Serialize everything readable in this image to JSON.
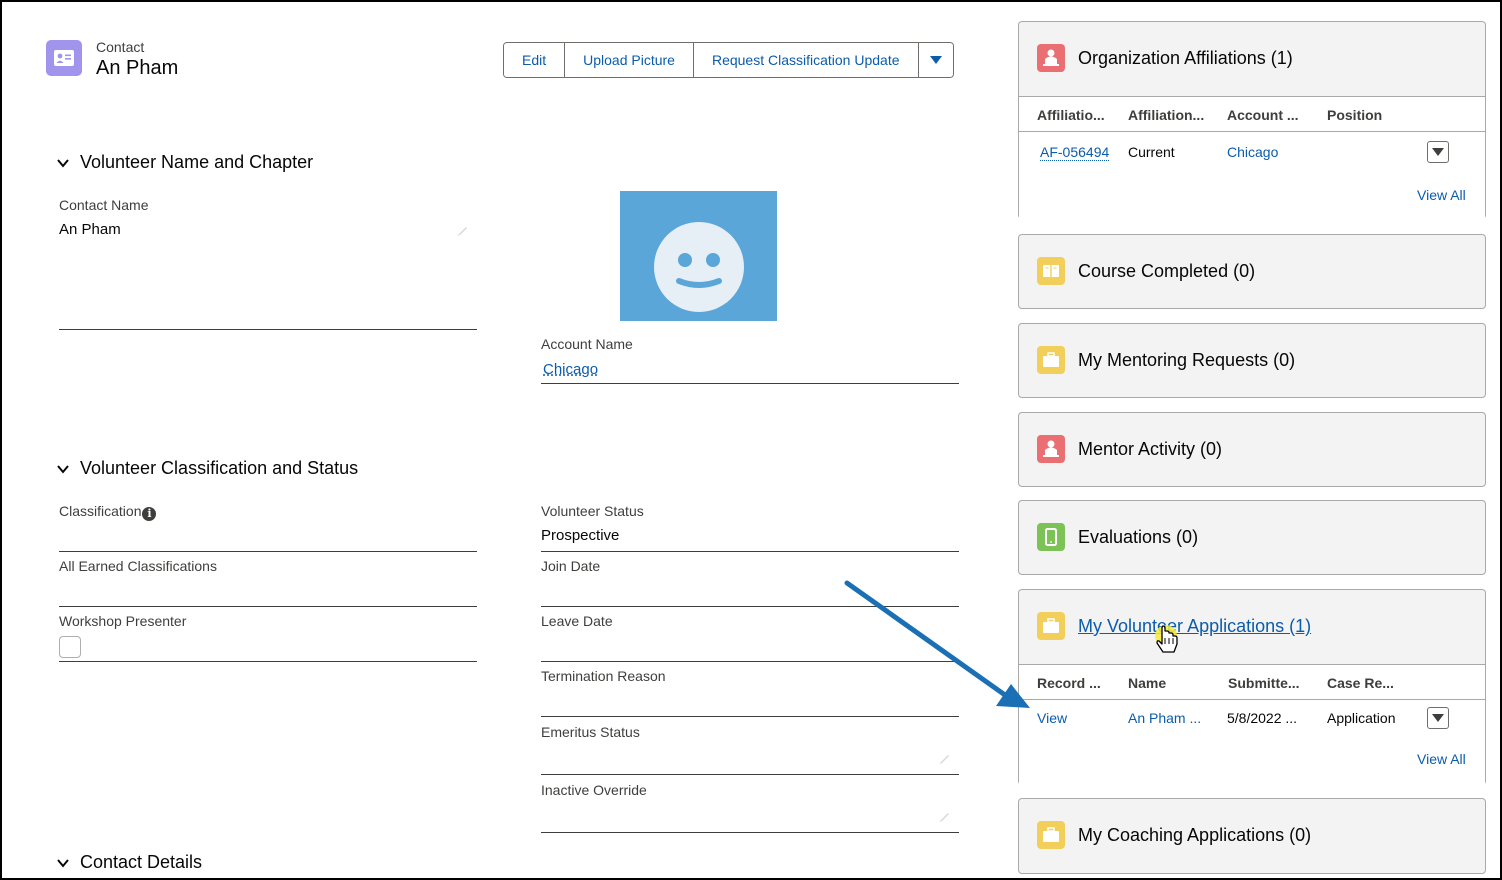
{
  "header": {
    "object_type": "Contact",
    "record_name": "An Pham",
    "actions": [
      {
        "label": "Edit"
      },
      {
        "label": "Upload Picture"
      },
      {
        "label": "Request Classification Update"
      }
    ],
    "colors": {
      "contact_icon": "#a094ed",
      "link": "#0b5cab"
    }
  },
  "sections": {
    "name_chapter": {
      "title": "Volunteer Name and Chapter",
      "contact_name_label": "Contact Name",
      "contact_name_value": "An Pham",
      "account_name_label": "Account Name",
      "account_name_value": "Chicago"
    },
    "classification_status": {
      "title": "Volunteer Classification and Status",
      "classification_label": "Classification",
      "info_glyph": "i",
      "all_earned_label": "All Earned Classifications",
      "workshop_presenter_label": "Workshop Presenter",
      "volunteer_status_label": "Volunteer Status",
      "volunteer_status_value": "Prospective",
      "join_date_label": "Join Date",
      "leave_date_label": "Leave Date",
      "termination_reason_label": "Termination Reason",
      "emeritus_status_label": "Emeritus Status",
      "inactive_override_label": "Inactive Override"
    },
    "contact_details": {
      "title": "Contact Details"
    }
  },
  "related": {
    "org_affiliations": {
      "title": "Organization Affiliations (1)",
      "icon": "person-icon",
      "color": "#ea6f73",
      "columns": [
        "Affiliatio...",
        "Affiliation...",
        "Account ...",
        "Position"
      ],
      "rows": [
        [
          "AF-056494",
          "Current",
          "Chicago",
          ""
        ]
      ],
      "view_all": "View All"
    },
    "courses": {
      "title": "Course Completed (0)",
      "icon": "book-icon",
      "color": "#f2cf5b"
    },
    "mentoring_requests": {
      "title": "My Mentoring Requests (0)",
      "icon": "briefcase-icon",
      "color": "#f2cf5b"
    },
    "mentor_activity": {
      "title": "Mentor Activity (0)",
      "icon": "person-icon",
      "color": "#ea6f73"
    },
    "evaluations": {
      "title": "Evaluations (0)",
      "icon": "tablet-icon",
      "color": "#7cc256"
    },
    "volunteer_applications": {
      "title": "My Volunteer Applications (1)",
      "icon": "briefcase-icon",
      "color": "#f2cf5b",
      "columns": [
        "Record ...",
        "Name",
        "Submitte...",
        "Case Re..."
      ],
      "rows": [
        [
          "View",
          "An Pham ...",
          "5/8/2022 ...",
          "Application"
        ]
      ],
      "view_all": "View All"
    },
    "coaching_applications": {
      "title": "My Coaching Applications (0)",
      "icon": "briefcase-icon",
      "color": "#f2cf5b"
    }
  }
}
